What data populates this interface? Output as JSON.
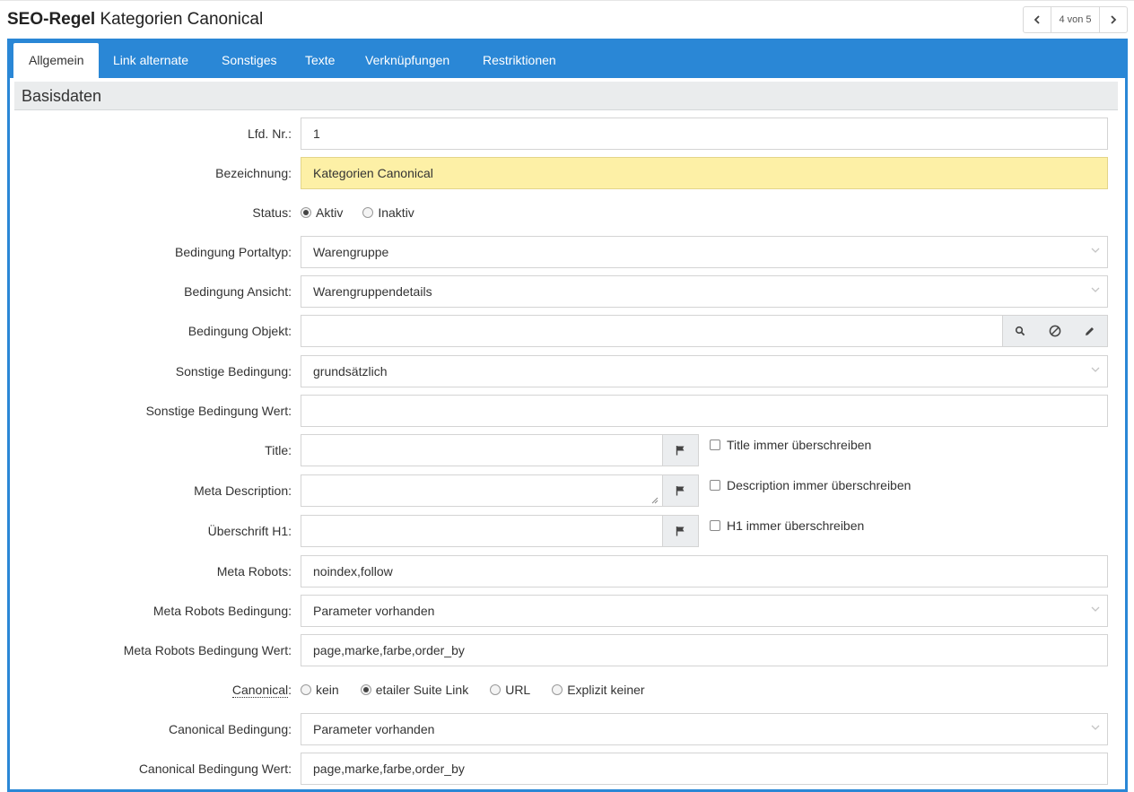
{
  "header": {
    "title_bold": "SEO-Regel",
    "title_rest": "Kategorien Canonical",
    "pager": {
      "prev_icon": "chevron-left-icon",
      "count": "4 von 5",
      "next_icon": "chevron-right-icon"
    }
  },
  "tabs": [
    {
      "label": "Allgemein",
      "active": true
    },
    {
      "label": "Link alternate"
    },
    {
      "label": "Sonstiges"
    },
    {
      "label": "Texte"
    },
    {
      "label": "Verknüpfungen"
    },
    {
      "label": "Restriktionen"
    }
  ],
  "section": {
    "title": "Basisdaten"
  },
  "form": {
    "lfd_nr": {
      "label": "Lfd. Nr.:",
      "value": "1"
    },
    "bezeichnung": {
      "label": "Bezeichnung:",
      "value": "Kategorien Canonical"
    },
    "status": {
      "label": "Status:",
      "options": [
        "Aktiv",
        "Inaktiv"
      ],
      "selected": "Aktiv"
    },
    "portaltyp": {
      "label": "Bedingung Portaltyp:",
      "value": "Warengruppe"
    },
    "ansicht": {
      "label": "Bedingung Ansicht:",
      "value": "Warengruppendetails"
    },
    "objekt": {
      "label": "Bedingung Objekt:",
      "value": ""
    },
    "sonstige": {
      "label": "Sonstige Bedingung:",
      "value": "grundsätzlich"
    },
    "sonstige_wert": {
      "label": "Sonstige Bedingung Wert:",
      "value": ""
    },
    "title": {
      "label": "Title:",
      "value": "",
      "checkbox": "Title immer überschreiben"
    },
    "meta_description": {
      "label": "Meta Description:",
      "value": "",
      "checkbox": "Description immer überschreiben"
    },
    "h1": {
      "label": "Überschrift H1:",
      "value": "",
      "checkbox": "H1 immer überschreiben"
    },
    "meta_robots": {
      "label": "Meta Robots:",
      "value": "noindex,follow"
    },
    "meta_robots_bedingung": {
      "label": "Meta Robots Bedingung:",
      "value": "Parameter vorhanden"
    },
    "meta_robots_bedingung_wert": {
      "label": "Meta Robots Bedingung Wert:",
      "value": "page,marke,farbe,order_by"
    },
    "canonical": {
      "label": "Canonical",
      "colon": ":",
      "options": [
        "kein",
        "etailer Suite Link",
        "URL",
        "Explizit keiner"
      ],
      "selected": "etailer Suite Link"
    },
    "canonical_bedingung": {
      "label": "Canonical Bedingung:",
      "value": "Parameter vorhanden"
    },
    "canonical_bedingung_wert": {
      "label": "Canonical Bedingung Wert:",
      "value": "page,marke,farbe,order_by"
    }
  },
  "colors": {
    "accent": "#2a87d6",
    "highlight_field": "#fdf0a6",
    "section_bg": "#eaeced"
  }
}
